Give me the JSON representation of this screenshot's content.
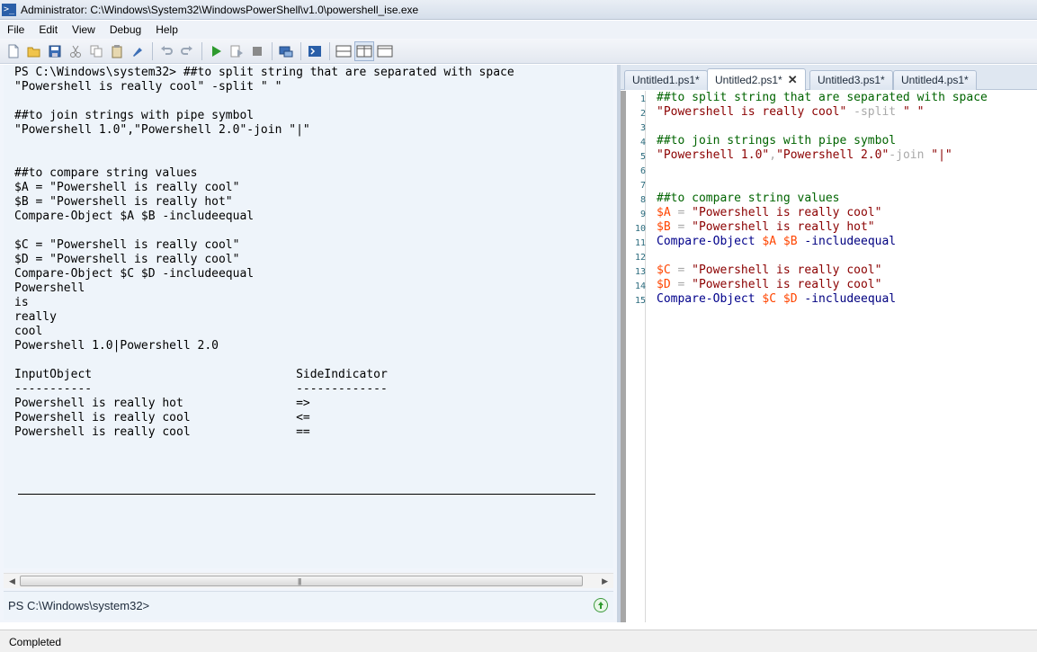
{
  "window": {
    "title": "Administrator: C:\\Windows\\System32\\WindowsPowerShell\\v1.0\\powershell_ise.exe",
    "icon": "powershell-icon"
  },
  "menu": [
    "File",
    "Edit",
    "View",
    "Debug",
    "Help"
  ],
  "toolbar": {
    "icons": [
      "new-icon",
      "open-icon",
      "save-icon",
      "cut-icon",
      "copy-icon",
      "paste-icon",
      "clear-icon",
      "undo-icon",
      "redo-icon",
      "run-icon",
      "run-selection-icon",
      "stop-icon",
      "new-remote-tab-icon",
      "powershell-console-icon",
      "layout-top-icon",
      "layout-side-icon",
      "layout-maximize-icon"
    ]
  },
  "console": {
    "output_lines": [
      "PS C:\\Windows\\system32> ##to split string that are separated with space",
      "\"Powershell is really cool\" -split \" \"",
      "",
      "##to join strings with pipe symbol",
      "\"Powershell 1.0\",\"Powershell 2.0\"-join \"|\"",
      "",
      "",
      "##to compare string values",
      "$A = \"Powershell is really cool\"",
      "$B = \"Powershell is really hot\"",
      "Compare-Object $A $B -includeequal",
      "",
      "$C = \"Powershell is really cool\"",
      "$D = \"Powershell is really cool\"",
      "Compare-Object $C $D -includeequal",
      "Powershell",
      "is",
      "really",
      "cool",
      "Powershell 1.0|Powershell 2.0",
      "",
      "InputObject                             SideIndicator",
      "-----------                             -------------",
      "Powershell is really hot                =>",
      "Powershell is really cool               <=",
      "Powershell is really cool               =="
    ],
    "prompt": "PS C:\\Windows\\system32>"
  },
  "tabs": [
    {
      "label": "Untitled1.ps1*",
      "active": false
    },
    {
      "label": "Untitled2.ps1*",
      "active": true
    },
    {
      "label": "Untitled3.ps1*",
      "active": false
    },
    {
      "label": "Untitled4.ps1*",
      "active": false
    }
  ],
  "editor": {
    "line_numbers": [
      "1",
      "2",
      "3",
      "4",
      "5",
      "6",
      "7",
      "8",
      "9",
      "10",
      "11",
      "12",
      "13",
      "14",
      "15"
    ],
    "lines": [
      [
        {
          "t": "##to split string that are separated with space",
          "c": "c-comment"
        }
      ],
      [
        {
          "t": "\"Powershell is really cool\"",
          "c": "c-string"
        },
        {
          "t": " -split ",
          "c": "c-op"
        },
        {
          "t": "\" \"",
          "c": "c-string"
        }
      ],
      [],
      [
        {
          "t": "##to join strings with pipe symbol",
          "c": "c-comment"
        }
      ],
      [
        {
          "t": "\"Powershell 1.0\"",
          "c": "c-string"
        },
        {
          "t": ",",
          "c": "c-op"
        },
        {
          "t": "\"Powershell 2.0\"",
          "c": "c-string"
        },
        {
          "t": "-join ",
          "c": "c-op"
        },
        {
          "t": "\"|\"",
          "c": "c-string"
        }
      ],
      [],
      [],
      [
        {
          "t": "##to compare string values",
          "c": "c-comment"
        }
      ],
      [
        {
          "t": "$A",
          "c": "c-var"
        },
        {
          "t": " = ",
          "c": "c-op"
        },
        {
          "t": "\"Powershell is really cool\"",
          "c": "c-string"
        }
      ],
      [
        {
          "t": "$B",
          "c": "c-var"
        },
        {
          "t": " = ",
          "c": "c-op"
        },
        {
          "t": "\"Powershell is really hot\"",
          "c": "c-string"
        }
      ],
      [
        {
          "t": "Compare-Object",
          "c": "c-cmd"
        },
        {
          "t": " ",
          "c": "c-op"
        },
        {
          "t": "$A",
          "c": "c-var"
        },
        {
          "t": " ",
          "c": "c-op"
        },
        {
          "t": "$B",
          "c": "c-var"
        },
        {
          "t": " -includeequal",
          "c": "c-param"
        }
      ],
      [],
      [
        {
          "t": "$C",
          "c": "c-var"
        },
        {
          "t": " = ",
          "c": "c-op"
        },
        {
          "t": "\"Powershell is really cool\"",
          "c": "c-string"
        }
      ],
      [
        {
          "t": "$D",
          "c": "c-var"
        },
        {
          "t": " = ",
          "c": "c-op"
        },
        {
          "t": "\"Powershell is really cool\"",
          "c": "c-string"
        }
      ],
      [
        {
          "t": "Compare-Object",
          "c": "c-cmd"
        },
        {
          "t": " ",
          "c": "c-op"
        },
        {
          "t": "$C",
          "c": "c-var"
        },
        {
          "t": " ",
          "c": "c-op"
        },
        {
          "t": "$D",
          "c": "c-var"
        },
        {
          "t": " -includeequal",
          "c": "c-param"
        }
      ]
    ]
  },
  "status": {
    "text": "Completed"
  }
}
